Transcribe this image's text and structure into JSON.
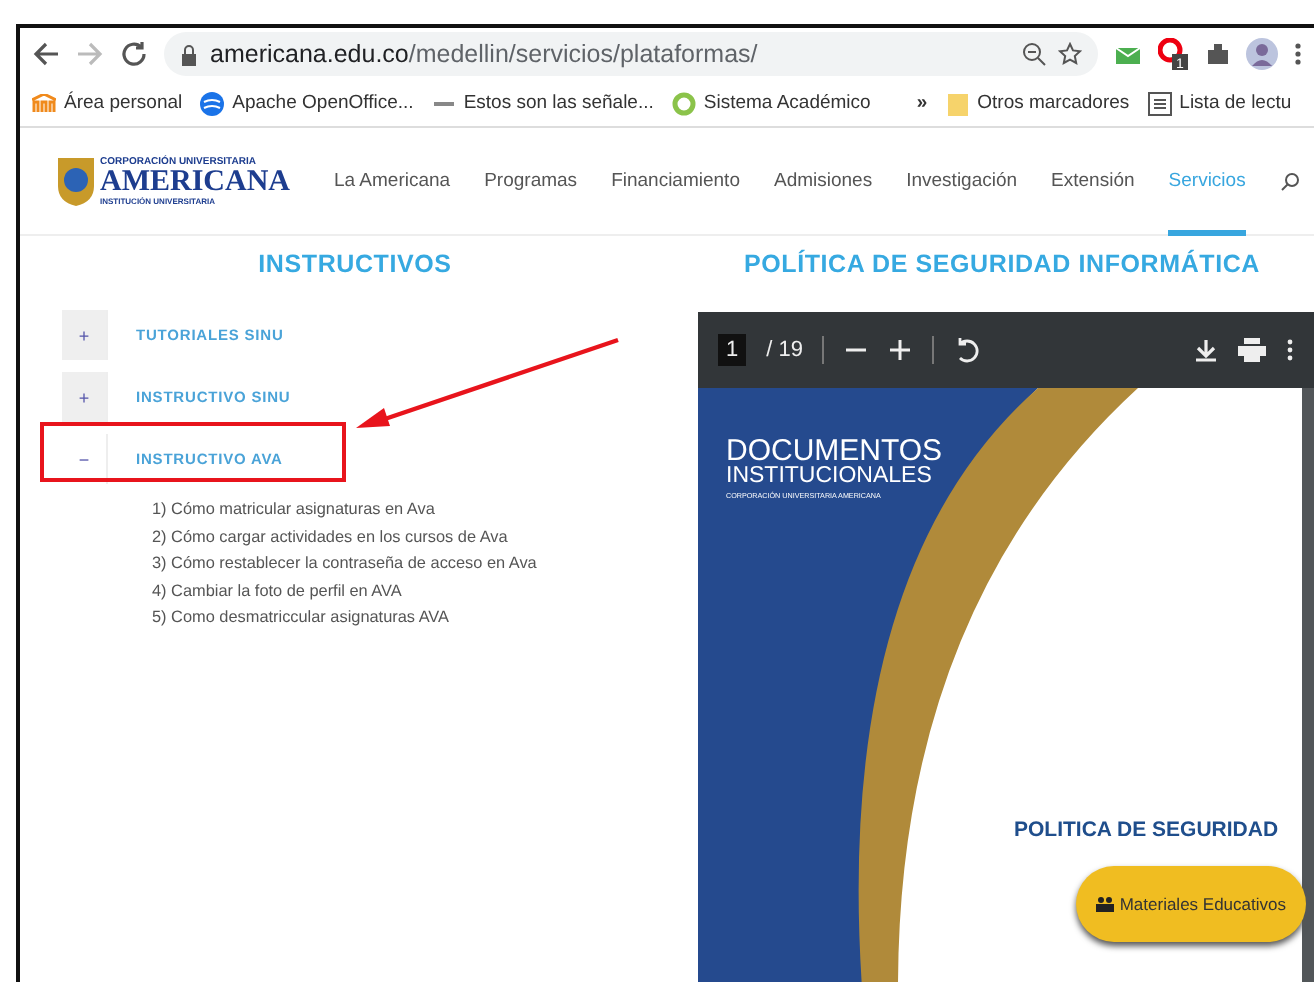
{
  "browser": {
    "url_host": "americana.edu.co",
    "url_path": "/medellin/servicios/plataformas/",
    "extension_badge": "1",
    "bookmarks": [
      {
        "label": "Área personal",
        "kind": "moodle"
      },
      {
        "label": "Apache OpenOffice...",
        "kind": "globe"
      },
      {
        "label": "Estos son las señale...",
        "kind": "abc"
      },
      {
        "label": "Sistema Académico",
        "kind": "ring"
      }
    ],
    "overflow": "»",
    "other_bookmarks": "Otros marcadores",
    "reading_list": "Lista de lectu"
  },
  "site": {
    "logo": {
      "top": "CORPORACIÓN UNIVERSITARIA",
      "main": "AMERICANA",
      "sub": "INSTITUCIÓN UNIVERSITARIA"
    },
    "nav": [
      {
        "label": "La Americana",
        "selected": false
      },
      {
        "label": "Programas",
        "selected": false
      },
      {
        "label": "Financiamiento",
        "selected": false
      },
      {
        "label": "Admisiones",
        "selected": false
      },
      {
        "label": "Investigación",
        "selected": false
      },
      {
        "label": "Extensión",
        "selected": false
      },
      {
        "label": "Servicios",
        "selected": true
      }
    ],
    "left_heading": "INSTRUCTIVOS",
    "right_heading": "POLÍTICA DE SEGURIDAD INFORMÁTICA",
    "accordion": [
      {
        "label": "TUTORIALES SINU",
        "expanded": false,
        "toggle": "+",
        "highlighted": false
      },
      {
        "label": "INSTRUCTIVO SINU",
        "expanded": false,
        "toggle": "+",
        "highlighted": false
      },
      {
        "label": "INSTRUCTIVO AVA",
        "expanded": true,
        "toggle": "−",
        "highlighted": true,
        "children": [
          "1) Cómo matricular asignaturas en Ava",
          "2) Cómo cargar actividades en los cursos de Ava",
          "3) Cómo restablecer la contraseña de acceso en Ava",
          "4) Cambiar la foto de perfil en AVA",
          "5) Como desmatriccular asignaturas AVA"
        ]
      }
    ],
    "pdf": {
      "page": "1",
      "total": "/ 19",
      "cover_title": "DOCUMENTOS",
      "cover_subtitle": "INSTITUCIONALES",
      "cover_caption": "CORPORACIÓN UNIVERSITARIA AMERICANA",
      "cover_heading": "POLITICA DE SEGURIDAD"
    },
    "floating_button": "Materiales Educativos"
  }
}
